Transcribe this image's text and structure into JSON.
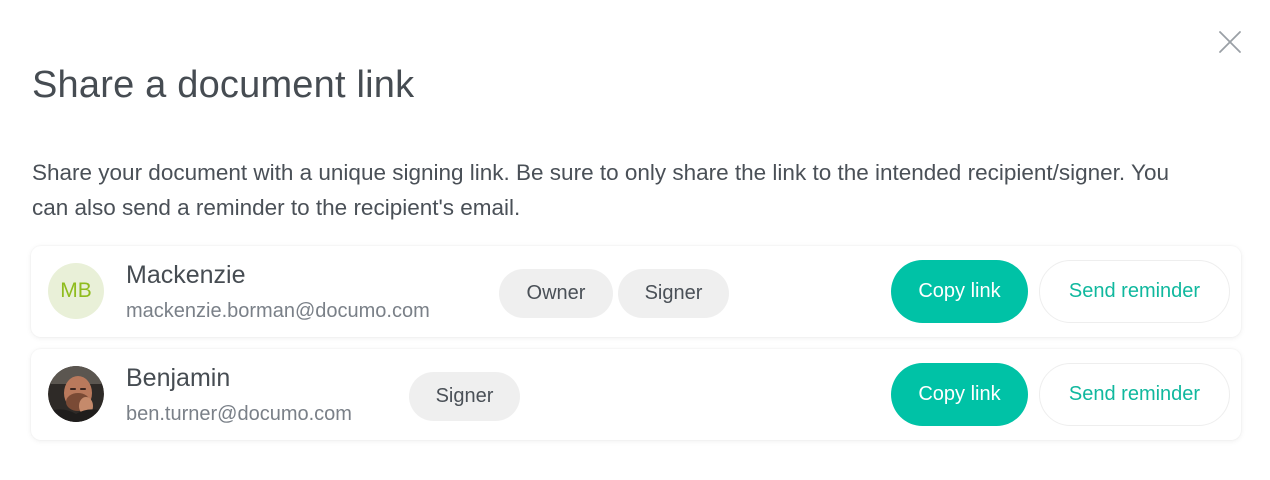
{
  "dialog": {
    "title": "Share a document link",
    "description": "Share your document with a unique signing link. Be sure to only share the link to the intended recipient/signer. You can also send a reminder to the recipient's email.",
    "close_icon": "close-icon"
  },
  "recipients": [
    {
      "initials": "MB",
      "name": "Mackenzie",
      "email": "mackenzie.borman@documo.com",
      "roles": [
        "Owner",
        "Signer"
      ],
      "copy_label": "Copy link",
      "remind_label": "Send reminder"
    },
    {
      "avatar": "user-photo-avatar",
      "name": "Benjamin",
      "email": "ben.turner@documo.com",
      "roles": [
        "Signer"
      ],
      "copy_label": "Copy link",
      "remind_label": "Send reminder"
    }
  ],
  "colors": {
    "accent": "#00c2a6",
    "accent_text": "#10b89e",
    "pill_bg": "#efefef",
    "initials_bg": "#e9f0d8",
    "initials_text": "#8fbc1e"
  }
}
